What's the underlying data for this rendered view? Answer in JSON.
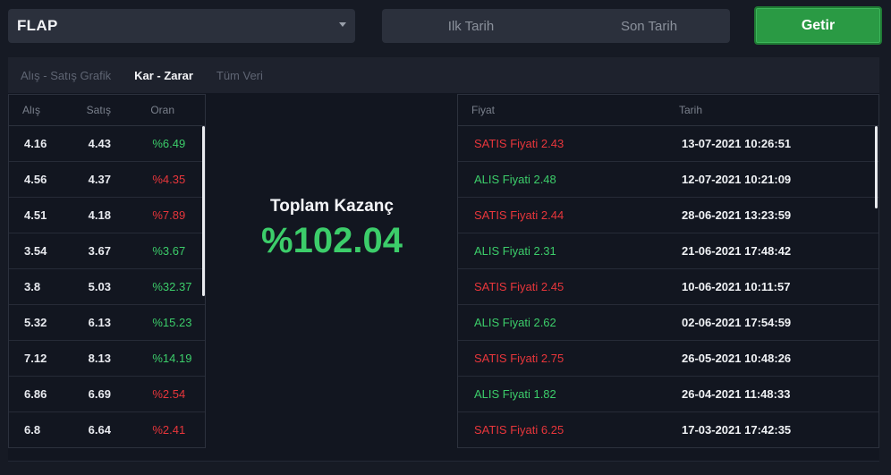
{
  "symbol_select": {
    "value": "FLAP"
  },
  "date_range": {
    "start_placeholder": "Ilk Tarih",
    "end_placeholder": "Son Tarih"
  },
  "submit": {
    "label": "Getir"
  },
  "tabs": [
    {
      "label": "Alış - Satış Grafik",
      "active": false
    },
    {
      "label": "Kar - Zarar",
      "active": true
    },
    {
      "label": "Tüm Veri",
      "active": false
    }
  ],
  "trades_table": {
    "headers": [
      "Alış",
      "Satış",
      "Oran"
    ],
    "rows": [
      {
        "alis": "4.16",
        "satis": "4.43",
        "oran": "%6.49",
        "dir": "pos"
      },
      {
        "alis": "4.56",
        "satis": "4.37",
        "oran": "%4.35",
        "dir": "neg"
      },
      {
        "alis": "4.51",
        "satis": "4.18",
        "oran": "%7.89",
        "dir": "neg"
      },
      {
        "alis": "3.54",
        "satis": "3.67",
        "oran": "%3.67",
        "dir": "pos"
      },
      {
        "alis": "3.8",
        "satis": "5.03",
        "oran": "%32.37",
        "dir": "pos"
      },
      {
        "alis": "5.32",
        "satis": "6.13",
        "oran": "%15.23",
        "dir": "pos"
      },
      {
        "alis": "7.12",
        "satis": "8.13",
        "oran": "%14.19",
        "dir": "pos"
      },
      {
        "alis": "6.86",
        "satis": "6.69",
        "oran": "%2.54",
        "dir": "neg"
      },
      {
        "alis": "6.8",
        "satis": "6.64",
        "oran": "%2.41",
        "dir": "neg"
      }
    ]
  },
  "summary": {
    "title": "Toplam Kazanç",
    "value": "%102.04"
  },
  "orders_table": {
    "headers": [
      "Fiyat",
      "Tarih"
    ],
    "rows": [
      {
        "fiyat": "SATIS Fiyati 2.43",
        "tarih": "13-07-2021 10:26:51",
        "type": "neg"
      },
      {
        "fiyat": "ALIS Fiyati 2.48",
        "tarih": "12-07-2021 10:21:09",
        "type": "pos"
      },
      {
        "fiyat": "SATIS Fiyati 2.44",
        "tarih": "28-06-2021 13:23:59",
        "type": "neg"
      },
      {
        "fiyat": "ALIS Fiyati 2.31",
        "tarih": "21-06-2021 17:48:42",
        "type": "pos"
      },
      {
        "fiyat": "SATIS Fiyati 2.45",
        "tarih": "10-06-2021 10:11:57",
        "type": "neg"
      },
      {
        "fiyat": "ALIS Fiyati 2.62",
        "tarih": "02-06-2021 17:54:59",
        "type": "pos"
      },
      {
        "fiyat": "SATIS Fiyati 2.75",
        "tarih": "26-05-2021 10:48:26",
        "type": "neg"
      },
      {
        "fiyat": "ALIS Fiyati 1.82",
        "tarih": "26-04-2021 11:48:33",
        "type": "pos"
      },
      {
        "fiyat": "SATIS Fiyati 6.25",
        "tarih": "17-03-2021 17:42:35",
        "type": "neg"
      }
    ]
  },
  "colors": {
    "positive": "#3ccd6a",
    "negative": "#e8363b",
    "accent_button": "#2a9a44"
  }
}
